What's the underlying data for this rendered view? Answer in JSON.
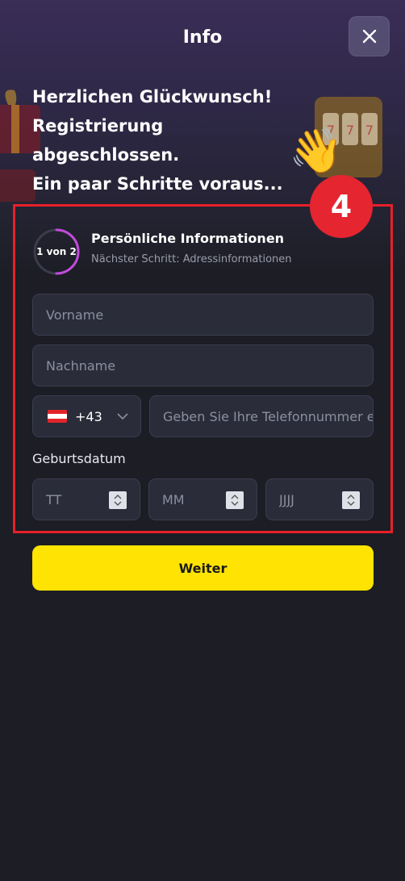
{
  "header": {
    "title": "Info"
  },
  "headline": {
    "line1": "Herzlichen Glückwunsch!",
    "line2": "Registrierung",
    "line3": "abgeschlossen.",
    "line4": "Ein paar Schritte voraus..."
  },
  "annotation": {
    "step_number": "4"
  },
  "step": {
    "progress_label": "1 von 2",
    "progress_fraction": 0.5,
    "title": "Persönliche Informationen",
    "subtitle": "Nächster Schritt: Adressinformationen"
  },
  "form": {
    "first_name_placeholder": "Vorname",
    "last_name_placeholder": "Nachname",
    "country_code": "+43",
    "phone_placeholder": "Geben Sie Ihre Telefonnummer ein",
    "birthdate_label": "Geburtsdatum",
    "day_placeholder": "TT",
    "month_placeholder": "MM",
    "year_placeholder": "JJJJ"
  },
  "actions": {
    "next_label": "Weiter"
  },
  "colors": {
    "accent_yellow": "#ffe302",
    "highlight_red": "#e8202a",
    "progress_ring": "#c24bdc",
    "background": "#1c1d25"
  }
}
